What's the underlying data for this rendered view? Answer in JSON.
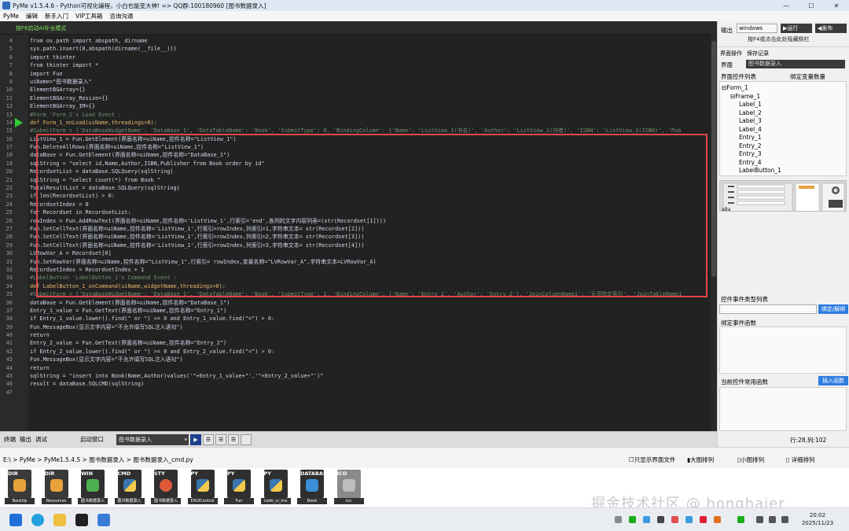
{
  "window": {
    "title": "PyMe v1.5.4.6 - Python可视化编程，小白也能变大神!  => QQ群:100180960    [图书数据录入]",
    "minimize": "—",
    "maximize": "☐",
    "close": "✕"
  },
  "menu": [
    "PyMe",
    "编辑",
    "新手入门",
    "VIP工具箱",
    "咨询沟通"
  ],
  "editor": {
    "hint": "按F6启动AI补全模式",
    "current_line": 14,
    "lines": [
      {
        "n": "4",
        "t": "from   os.path import abspath, dirname",
        "k": "s"
      },
      {
        "n": "5",
        "t": "sys.path.insert(0,abspath(dirname(__file__)))",
        "k": "s"
      },
      {
        "n": "6",
        "t": "import tkinter",
        "k": "s"
      },
      {
        "n": "7",
        "t": "from   tkinter import *",
        "k": "s"
      },
      {
        "n": "8",
        "t": "import Fun",
        "k": "s"
      },
      {
        "n": "9",
        "t": "uiName=\"图书数据录入\"",
        "k": "s"
      },
      {
        "n": "10",
        "t": "ElementBGArray={}",
        "k": "s"
      },
      {
        "n": "11",
        "t": "ElementBGArray_Resize={}",
        "k": "s"
      },
      {
        "n": "12",
        "t": "ElementBGArray_IM={}",
        "k": "s"
      },
      {
        "n": "13",
        "t": "#Form 'Form_1's Load Event :",
        "k": "c"
      },
      {
        "n": "14",
        "t": "def Form_1_onLoad(uiName,threadings=0):",
        "k": "k"
      },
      {
        "n": "15",
        "t": "    #SubmitForm = {'DataBaseWidgetName': 'DataBase_1', 'DataTableName': 'Book', 'SubmitType': 0, 'BindingColumn': {'Name': 'ListView_1(书名)', 'Author': 'ListView_1(作者)', 'ISBN': 'ListView_1(ISBN)', 'Pub",
        "k": "c"
      },
      {
        "n": "16",
        "t": "    ListView_1 = Fun.GetElement(界面名称=uiName,控件名称=\"ListView_1\")",
        "k": "s"
      },
      {
        "n": "17",
        "t": "    Fun.DeleteAllRows(界面名称=uiName,控件名称=\"ListView_1\")",
        "k": "s"
      },
      {
        "n": "18",
        "t": "    dataBase = Fun.GetElement(界面名称=uiName,控件名称=\"DataBase_1\")",
        "k": "s"
      },
      {
        "n": "19",
        "t": "    sqlString = \"select id,Name,Author,ISBN,Publisher from Book order by id\"",
        "k": "s"
      },
      {
        "n": "20",
        "t": "    RecordsetList = dataBase.SQLQuery(sqlString)",
        "k": "s"
      },
      {
        "n": "21",
        "t": "    sqlString = \"select count(*) from Book \"",
        "k": "s"
      },
      {
        "n": "22",
        "t": "    TotalResultList = dataBase.SQLQuery(sqlString)",
        "k": "s"
      },
      {
        "n": "23",
        "t": "    if len(RecordsetList) > 0:",
        "k": "s"
      },
      {
        "n": "24",
        "t": "        RecordsetIndex = 0",
        "k": "s"
      },
      {
        "n": "25",
        "t": "        for Recordset in RecordsetList:",
        "k": "s"
      },
      {
        "n": "26",
        "t": "            rowIndex = Fun.AddRowText(界面名称=uiName,控件名称='ListView_1',行索引='end',各列的文字内容列表=(str(Recordset[1])))",
        "k": "s"
      },
      {
        "n": "27",
        "t": "            Fun.SetCellText(界面名称=uiName,控件名称='ListView_1',行索引=rowIndex,列索引=1,字符串文本= str(Recordset[2]))",
        "k": "s"
      },
      {
        "n": "28",
        "t": "            Fun.SetCellText(界面名称=uiName,控件名称='ListView_1',行索引=rowIndex,列索引=2,字符串文本= str(Recordset[3]))",
        "k": "s"
      },
      {
        "n": "29",
        "t": "            Fun.SetCellText(界面名称=uiName,控件名称='ListView_1',行索引=rowIndex,列索引=3,字符串文本= str(Recordset[4]))",
        "k": "s"
      },
      {
        "n": "30",
        "t": "            LVRowVar_A = Recordset[0]",
        "k": "s"
      },
      {
        "n": "31",
        "t": "            Fun.SetRowVar(界面名称=uiName,控件名称=\"ListView_1\",行索引= rowIndex,变量名称=\"LVRowVar_A\",字符串文本=LVRowVar_A)",
        "k": "s"
      },
      {
        "n": "32",
        "t": "            RecordsetIndex = RecordsetIndex + 1",
        "k": "s"
      },
      {
        "n": "33",
        "t": "#LabelButton 'LabelButton_1's Command Event :",
        "k": "c"
      },
      {
        "n": "34",
        "t": "def LabelButton_1_onCommand(uiName,widgetName,threadings=0):",
        "k": "k"
      },
      {
        "n": "35",
        "t": "    #SubmitForm = {'DataBaseWidgetName': 'DataBase_1', 'DataTableName': 'Book', 'SubmitType': 1, 'BindingColumn': {'Name': 'Entry_1', 'Author': 'Entry_2'}, 'JoinColumnName1': '无须指定索引', 'JoinTableName1",
        "k": "c"
      },
      {
        "n": "36",
        "t": "    dataBase = Fun.GetElement(界面名称=uiName,控件名称=\"DataBase_1\")",
        "k": "s"
      },
      {
        "n": "37",
        "t": "    Entry_1_value = Fun.GetText(界面名称=uiName,控件名称=\"Entry_1\")",
        "k": "s"
      },
      {
        "n": "38",
        "t": "    if Entry_1_value.lower().find(\" or \") >= 0 and Entry_1_value.find(\"=\") > 0:",
        "k": "s"
      },
      {
        "n": "39",
        "t": "        Fun.MessageBox(显示文字内容=\"不允许填写SQL注入语句\")",
        "k": "s"
      },
      {
        "n": "40",
        "t": "        return",
        "k": "s"
      },
      {
        "n": "41",
        "t": "    Entry_2_value = Fun.GetText(界面名称=uiName,控件名称=\"Entry_2\")",
        "k": "s"
      },
      {
        "n": "42",
        "t": "    if Entry_2_value.lower().find(\" or \") >= 0 and Entry_2_value.find(\"=\") > 0:",
        "k": "s"
      },
      {
        "n": "43",
        "t": "        Fun.MessageBox(显示文字内容=\"不允许填写SQL注入语句\")",
        "k": "s"
      },
      {
        "n": "44",
        "t": "        return",
        "k": "s"
      },
      {
        "n": "45",
        "t": "    sqlString = \"insert into Book(Name,Author)values('\"+Entry_1_value+\"','\"+Entry_2_value+\"')\"",
        "k": "s"
      },
      {
        "n": "46",
        "t": "    result = dataBase.SQLCMD(sqlString)",
        "k": "s"
      },
      {
        "n": "47",
        "t": "",
        "k": "s"
      }
    ]
  },
  "bottom_tabs": [
    "终端",
    "输出",
    "调试"
  ],
  "start_window_label": "启动窗口",
  "start_window_value": "图书数据录入",
  "right_panel": {
    "output_label": "输出",
    "os_value": "windows",
    "run_label": "▶运行",
    "publish_label": "◀发布",
    "f4_hint": "按F4或点击此处隐藏侧栏",
    "tabs": [
      "界面操作",
      "保存记录"
    ],
    "ui_label": "界面",
    "ui_value": "图书数据录入",
    "controls_label": "界面控件列表",
    "bind_vars_label": "绑定变量数量",
    "tree": [
      {
        "label": "⊟Form_1",
        "depth": 0
      },
      {
        "label": "⊟Frame_1",
        "depth": 1
      },
      {
        "label": "Label_1",
        "depth": 2
      },
      {
        "label": "Label_2",
        "depth": 2
      },
      {
        "label": "Label_3",
        "depth": 2
      },
      {
        "label": "Label_4",
        "depth": 2
      },
      {
        "label": "Entry_1",
        "depth": 2
      },
      {
        "label": "Entry_2",
        "depth": 2
      },
      {
        "label": "Entry_3",
        "depth": 2
      },
      {
        "label": "Entry_4",
        "depth": 2
      },
      {
        "label": "LabelButton_1",
        "depth": 2
      }
    ],
    "event_type_label": "控件事件类型列表",
    "bind_unbind_label": "绑定/解绑",
    "bound_events_label": "绑定事件函数",
    "common_funcs_label": "当前控件常用函数",
    "insert_func_label": "插入函数",
    "cursor_pos": "行:28,列:102"
  },
  "path_bar": {
    "path": "E:\\ > PyMe > PyMe1.5.4.5 > 图书数据录入 > 图书数据录入_cmd.py",
    "options": [
      "只显示界面文件",
      "大图排列",
      "小图排列",
      "详细排列"
    ]
  },
  "files": [
    {
      "tag": "DIR",
      "label": "BackUp",
      "color": "#3a3a3a"
    },
    {
      "tag": "DIR",
      "label": "Resources",
      "color": "#3a3a3a"
    },
    {
      "tag": "WIN",
      "label": "图书数据录入",
      "color": "#2f2f2f"
    },
    {
      "tag": "CMD",
      "label": "图书数据录入",
      "color": "#2f2f2f"
    },
    {
      "tag": "STY",
      "label": "图书数据录入",
      "color": "#2f2f2f"
    },
    {
      "tag": "PY",
      "label": "EXUIControl",
      "color": "#2f2f2f"
    },
    {
      "tag": "PY",
      "label": "Fun",
      "color": "#2f2f2f"
    },
    {
      "tag": "PY",
      "label": "code_ui_ma",
      "color": "#2f2f2f"
    },
    {
      "tag": "DATABAS",
      "label": "Book",
      "color": "#2f2f2f"
    },
    {
      "tag": "ICO",
      "label": "ico",
      "color": "#8a8a8a"
    }
  ],
  "watermark": "掘金技术社区 @ honghaier",
  "clock": {
    "time": "20:02",
    "date": "2025/11/23"
  },
  "colors": {
    "accent_green": "#35c835",
    "highlight_red": "#e0474c",
    "editor_bg": "#222222",
    "blue_button": "#2f7de0"
  }
}
